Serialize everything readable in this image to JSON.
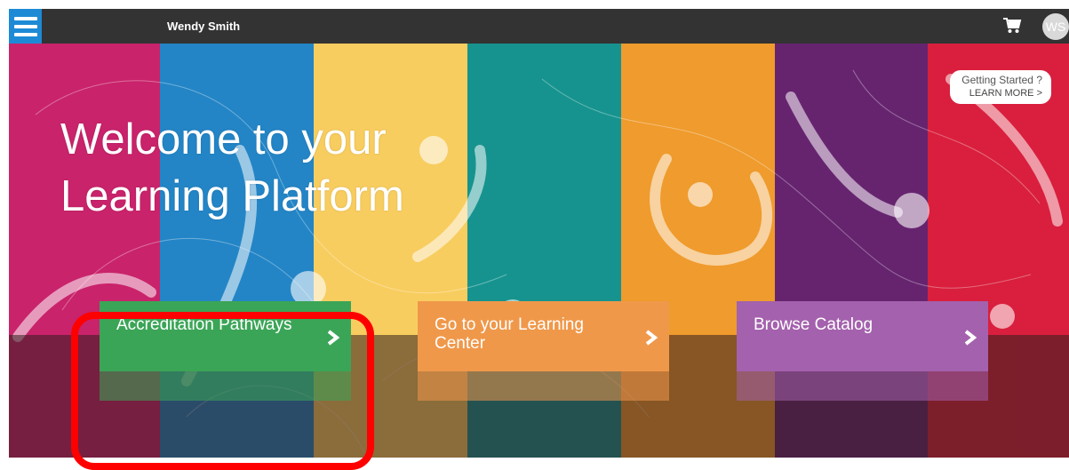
{
  "topbar": {
    "menu_icon": "hamburger-menu-icon",
    "user_name": "Wendy Smith",
    "cart_icon": "shopping-cart-icon",
    "avatar_initials": "WS"
  },
  "hero": {
    "title_line1": "Welcome to your",
    "title_line2": "Learning Platform",
    "getting_started_label": "Getting Started ?",
    "learn_more_label": "LEARN MORE >",
    "stripe_colors": [
      "#c9236b",
      "#2385c6",
      "#f8cd5f",
      "#16938f",
      "#ef9b2d",
      "#66246f",
      "#d91f3d"
    ]
  },
  "tiles": [
    {
      "label": "Accreditation Pathways",
      "color": "#3ba557",
      "icon": "chevron-right-icon"
    },
    {
      "label": "Go to your Learning Center",
      "color": "#f0984a",
      "icon": "chevron-right-icon"
    },
    {
      "label": "Browse Catalog",
      "color": "#a461ad",
      "icon": "chevron-right-icon"
    }
  ],
  "annotation": {
    "highlight_color": "#ff0000"
  }
}
